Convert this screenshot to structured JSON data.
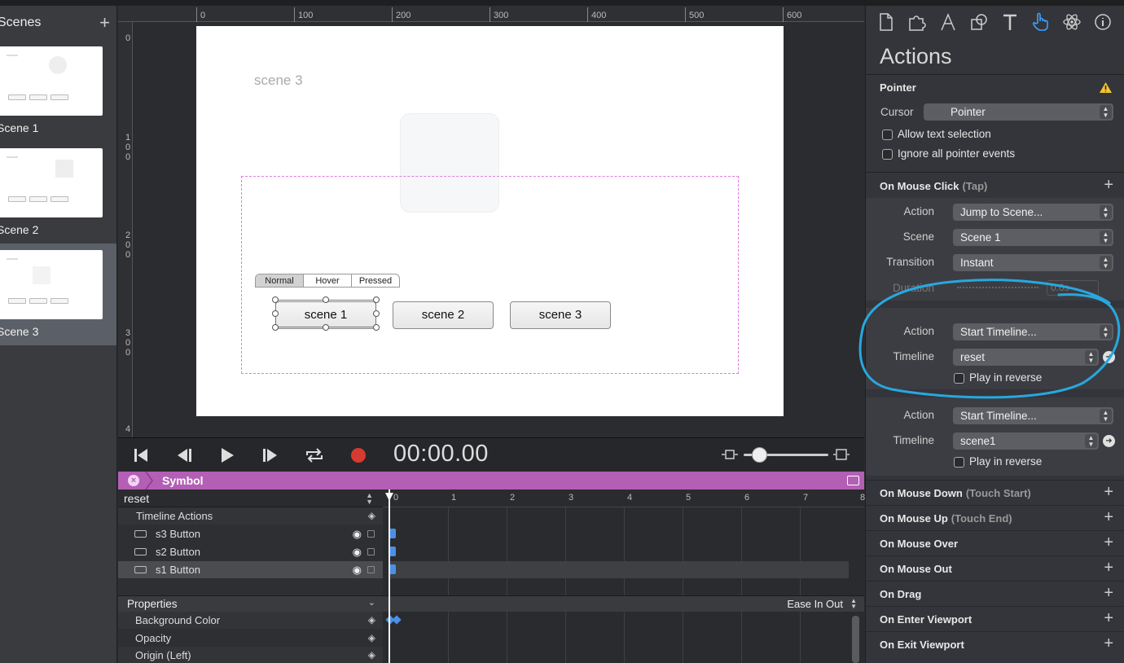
{
  "scenes_panel": {
    "title": "Scenes",
    "add": "+",
    "items": [
      {
        "label": "Scene 1",
        "thumb_buttons": [
          "scene 1",
          "scene 2",
          "scene 3"
        ]
      },
      {
        "label": "Scene 2",
        "thumb_buttons": [
          "scene 1",
          "scene 2",
          "scene 3"
        ]
      },
      {
        "label": "Scene 3",
        "thumb_buttons": [
          "scene 1",
          "scene 2",
          "scene 3"
        ]
      }
    ]
  },
  "rulers": {
    "top": [
      "0",
      "100",
      "200",
      "300",
      "400",
      "500",
      "600"
    ],
    "left": [
      "0",
      "1\n0\n0",
      "2\n0\n0",
      "3\n0\n0",
      "4"
    ]
  },
  "stage": {
    "scene_title": "scene 3",
    "state_tabs": [
      "Normal",
      "Hover",
      "Pressed"
    ],
    "active_state": "Normal",
    "buttons": [
      "scene 1",
      "scene 2",
      "scene 3"
    ],
    "selected_button": "scene 1"
  },
  "transport": {
    "timecode": "00:00.00",
    "icons": [
      "skip-to-start-icon",
      "step-back-icon",
      "play-icon",
      "step-forward-icon",
      "loop-icon",
      "record-icon"
    ],
    "record_color": "#d63a30"
  },
  "symbol_bar": {
    "name": "Symbol",
    "close": "×",
    "color": "#b35fb5"
  },
  "timeline": {
    "current": "reset",
    "rows": [
      {
        "label": "Timeline Actions"
      },
      {
        "label": "s3 Button"
      },
      {
        "label": "s2 Button"
      },
      {
        "label": "s1 Button"
      }
    ],
    "ruler": [
      "0",
      "1",
      "2",
      "3",
      "4",
      "5",
      "6",
      "7",
      "8"
    ],
    "properties": {
      "title": "Properties",
      "easing": "Ease In Out",
      "items": [
        "Background Color",
        "Opacity",
        "Origin (Left)"
      ]
    },
    "keyframe_color": "#4a8fe8"
  },
  "right_panel": {
    "tools": [
      "document-icon",
      "puzzle-icon",
      "pen-icon",
      "shapes-icon",
      "text-icon",
      "hand-pointer-icon",
      "atom-icon",
      "info-icon"
    ],
    "active_tool": "hand-pointer-icon",
    "title": "Actions",
    "pointer": {
      "title": "Pointer",
      "cursor_label": "Cursor",
      "cursor_value": "Pointer",
      "allow_text": "Allow text selection",
      "ignore_events": "Ignore all pointer events"
    },
    "mouse_click": {
      "title": "On Mouse Click",
      "sub": "(Tap)",
      "action1": {
        "action_label": "Action",
        "action_value": "Jump to Scene...",
        "scene_label": "Scene",
        "scene_value": "Scene 1",
        "transition_label": "Transition",
        "transition_value": "Instant",
        "duration_label": "Duration",
        "duration_value": "0.0s"
      },
      "action2": {
        "action_label": "Action",
        "action_value": "Start Timeline...",
        "timeline_label": "Timeline",
        "timeline_value": "reset",
        "reverse": "Play in reverse"
      },
      "action3": {
        "action_label": "Action",
        "action_value": "Start Timeline...",
        "timeline_label": "Timeline",
        "timeline_value": "scene1",
        "reverse": "Play in reverse"
      }
    },
    "events": [
      {
        "title": "On Mouse Down",
        "sub": "(Touch Start)"
      },
      {
        "title": "On Mouse Up",
        "sub": "(Touch End)"
      },
      {
        "title": "On Mouse Over",
        "sub": ""
      },
      {
        "title": "On Mouse Out",
        "sub": ""
      },
      {
        "title": "On Drag",
        "sub": ""
      },
      {
        "title": "On Enter Viewport",
        "sub": ""
      },
      {
        "title": "On Exit Viewport",
        "sub": ""
      }
    ],
    "accent": "#3aa0ff",
    "annotation_color": "#27a8e0"
  }
}
